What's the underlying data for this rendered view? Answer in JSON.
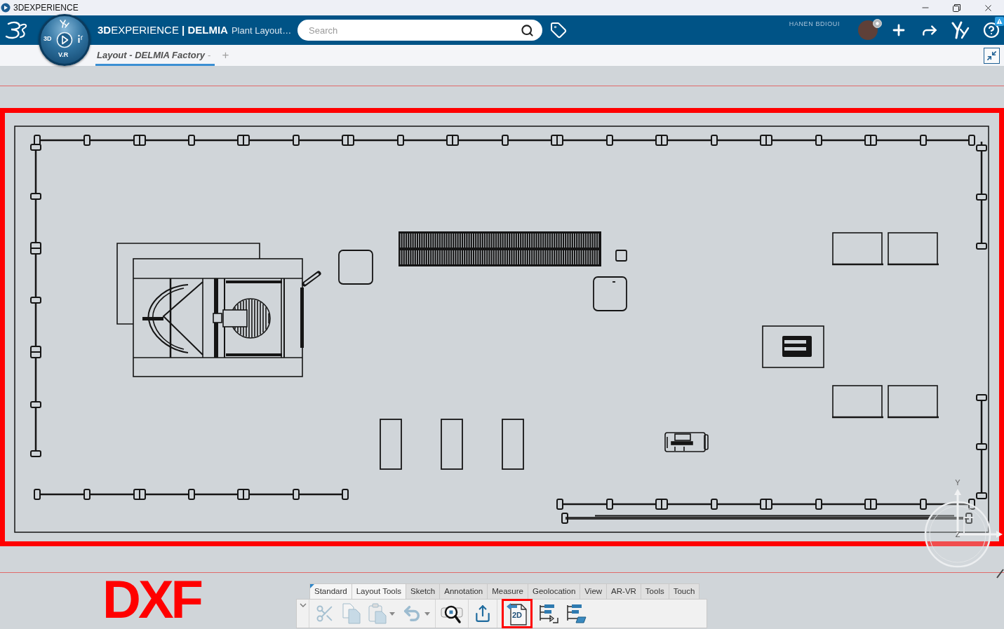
{
  "window": {
    "title": "3DEXPERIENCE"
  },
  "top_bar": {
    "title": "**3D**EXPERIENCE **| DELMIA**",
    "context": "Plant Layout…",
    "search": {
      "placeholder": "Search"
    },
    "user_name": "HANEN BDIOUI",
    "help_alert": true
  },
  "compass": {
    "left": "3D",
    "bottom": "V.R"
  },
  "tabs": [
    {
      "label": "Layout - DELMIA Factory",
      "marker": "-",
      "selected": true
    }
  ],
  "new_tab": "+",
  "viewer": {
    "highlighted": true,
    "axes": {
      "y": "Y",
      "z": "Z"
    }
  },
  "annotation": {
    "label": "DXF"
  },
  "action_bar": {
    "tabs": [
      {
        "label": "Standard",
        "selected": true,
        "active": true
      },
      {
        "label": "Layout Tools",
        "selected": false,
        "active": true
      },
      {
        "label": "Sketch",
        "selected": false,
        "active": false
      },
      {
        "label": "Annotation",
        "selected": false,
        "active": false
      },
      {
        "label": "Measure",
        "selected": false,
        "active": false
      },
      {
        "label": "Geolocation",
        "selected": false,
        "active": false
      },
      {
        "label": "View",
        "selected": false,
        "active": false
      },
      {
        "label": "AR-VR",
        "selected": false,
        "active": false
      },
      {
        "label": "Tools",
        "selected": false,
        "active": false
      },
      {
        "label": "Touch",
        "selected": false,
        "active": false
      }
    ],
    "tool_groups": [
      [
        {
          "kind": "cut",
          "disabled": true,
          "dropdown": false,
          "highlighted": false
        },
        {
          "kind": "copy",
          "disabled": true,
          "dropdown": false,
          "highlighted": false
        },
        {
          "kind": "paste",
          "disabled": true,
          "dropdown": true,
          "highlighted": false
        },
        {
          "kind": "undo",
          "disabled": true,
          "dropdown": true,
          "highlighted": false
        }
      ],
      [
        {
          "kind": "zoom",
          "disabled": false,
          "dropdown": false,
          "highlighted": false
        }
      ],
      [
        {
          "kind": "export",
          "disabled": false,
          "dropdown": false,
          "highlighted": false
        }
      ],
      [
        {
          "kind": "import-2d",
          "text": "2D",
          "disabled": false,
          "dropdown": false,
          "highlighted": true
        },
        {
          "kind": "tree-export",
          "disabled": false,
          "dropdown": false,
          "highlighted": false
        },
        {
          "kind": "tree-export-sheet",
          "disabled": false,
          "dropdown": false,
          "highlighted": false
        }
      ]
    ]
  }
}
